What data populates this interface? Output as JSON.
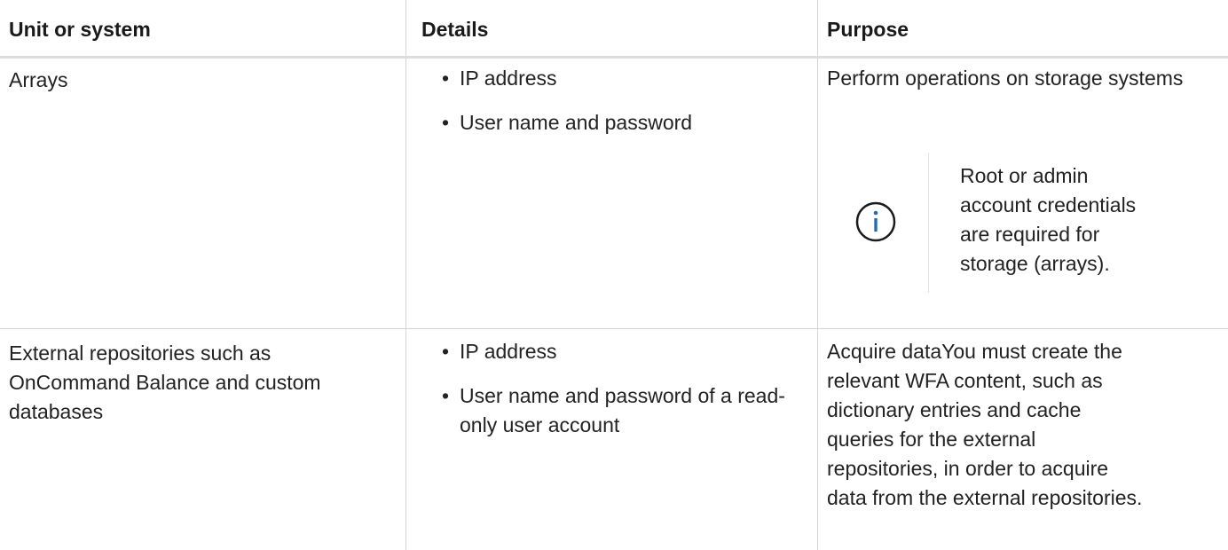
{
  "table": {
    "headers": [
      "Unit or system",
      "Details",
      "Purpose"
    ],
    "rows": [
      {
        "unit": "Arrays",
        "details": [
          "IP address",
          "User name and password"
        ],
        "purpose": "Perform operations on storage systems",
        "note": {
          "icon": "info-icon",
          "lines": [
            "Root or admin",
            "account credentials",
            "are required for",
            "storage (arrays)."
          ]
        }
      },
      {
        "unit_lines": [
          "External repositories such as",
          "OnCommand Balance and custom",
          "databases"
        ],
        "details": [
          "IP address",
          "User name and password of a read-only user account"
        ],
        "purpose_lines": [
          "Acquire dataYou must create the",
          "relevant WFA content, such as",
          "dictionary entries and cache",
          "queries for the external",
          "repositories, in order to acquire",
          "data from the external repositories."
        ]
      }
    ]
  },
  "colors": {
    "accent": "#1f6ebc",
    "border": "#d4d4d4",
    "header_rule": "#dcdcdc",
    "text": "#222222"
  }
}
